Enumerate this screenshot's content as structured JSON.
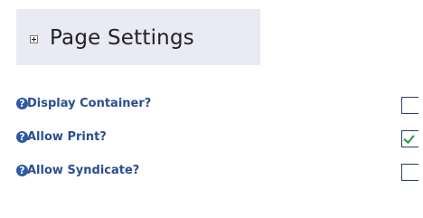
{
  "section": {
    "title": "Page Settings",
    "toggle_icon": "plus-box-icon"
  },
  "settings": [
    {
      "label": "Display Container?",
      "help_icon": "help-question-icon",
      "checked": false
    },
    {
      "label": "Allow Print?",
      "help_icon": "help-question-icon",
      "checked": true
    },
    {
      "label": "Allow Syndicate?",
      "help_icon": "help-question-icon",
      "checked": false
    }
  ],
  "colors": {
    "header_background": "#e9eaf4",
    "label_text": "#2a4f8f",
    "help_icon": "#2d5aa3",
    "check_mark": "#1e9c3a"
  }
}
